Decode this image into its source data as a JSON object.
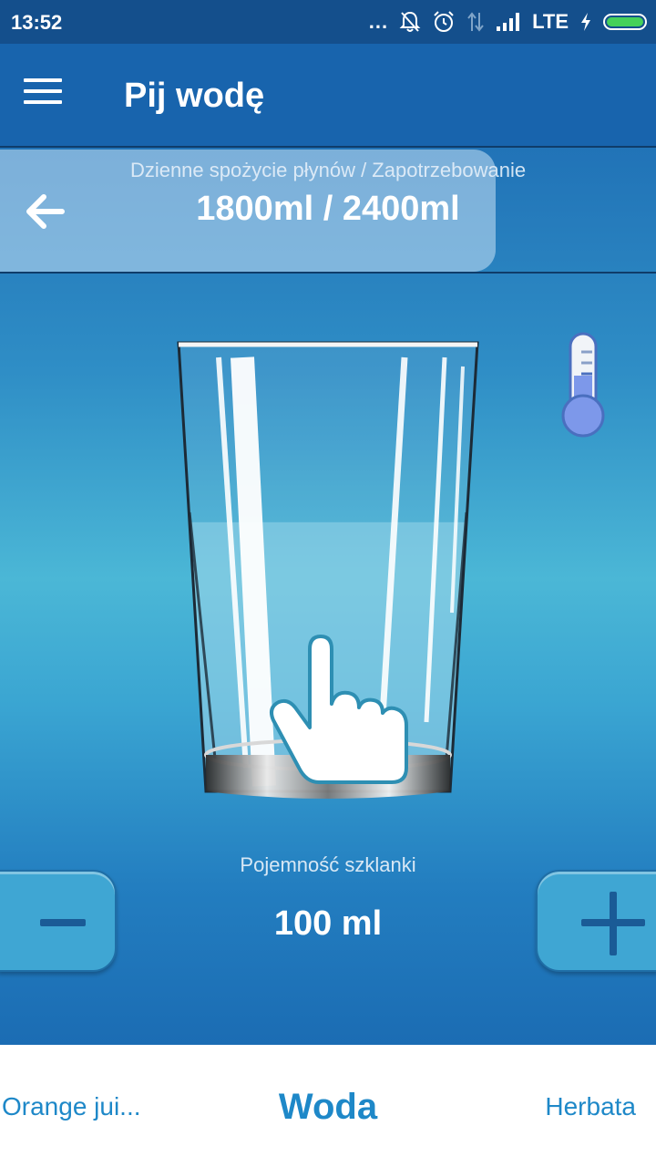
{
  "status_bar": {
    "time": "13:52",
    "dots": "...",
    "network": "LTE",
    "battery_level": 1.0,
    "icons": [
      "notifications-off-icon",
      "alarm-icon",
      "data-arrows-icon",
      "signal-icon",
      "charging-icon",
      "battery-icon"
    ]
  },
  "app_bar": {
    "title": "Pij wodę",
    "menu_icon": "hamburger-menu-icon"
  },
  "intake": {
    "label": "Dzienne spożycie płynów / Zapotrzebowanie",
    "value": "1800ml / 2400ml",
    "back_icon": "arrow-left-icon"
  },
  "glass": {
    "fill_fraction": 0.6,
    "hint_icon": "tap-hand-icon"
  },
  "thermometer": {
    "icon": "thermometer-icon"
  },
  "capacity": {
    "label": "Pojemność szklanki",
    "value": "100 ml"
  },
  "tabs": [
    {
      "label": "Orange jui..."
    },
    {
      "label": "Woda",
      "selected": true
    },
    {
      "label": "Herbata"
    }
  ],
  "colors": {
    "accent": "#1e88c8",
    "app_bar": "#1864ad",
    "status_bar": "#144f8c",
    "battery": "#45d15a"
  }
}
